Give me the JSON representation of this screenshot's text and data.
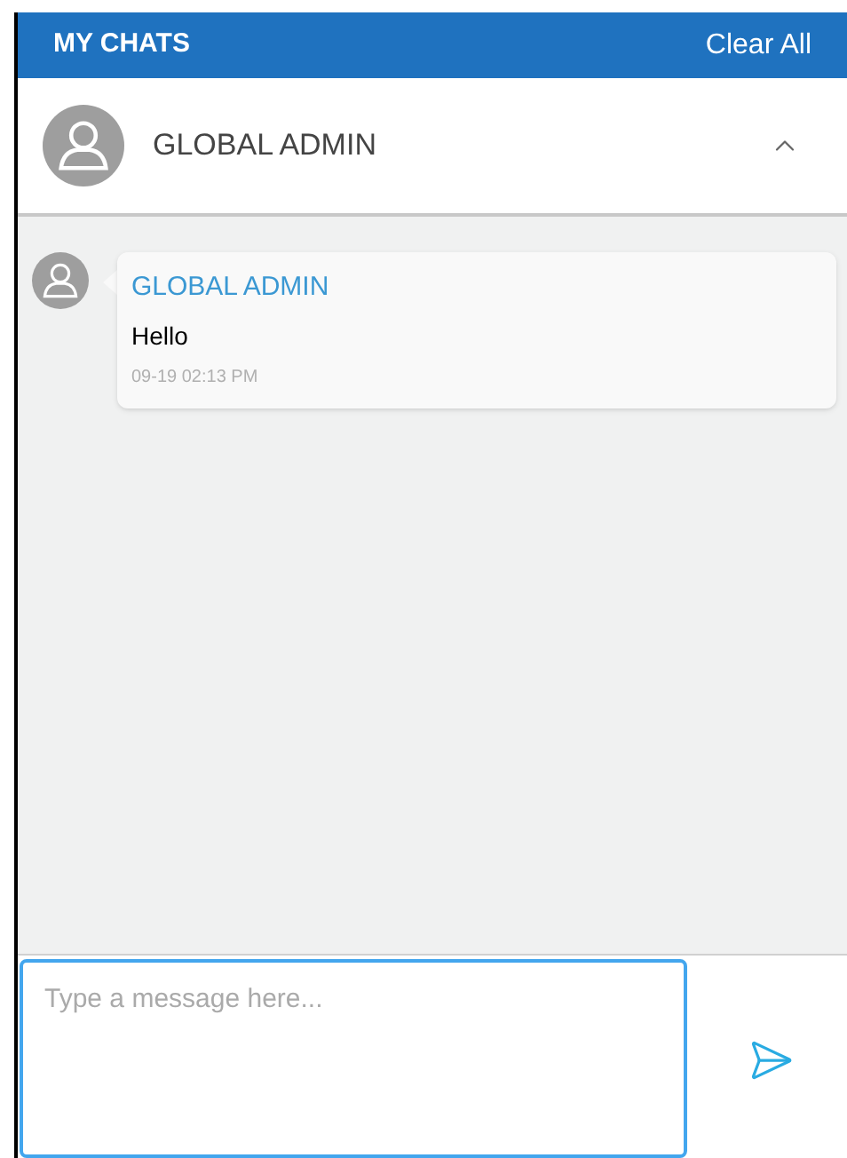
{
  "header": {
    "title": "MY CHATS",
    "action": "Clear All"
  },
  "contact": {
    "name": "GLOBAL ADMIN",
    "expanded": true
  },
  "messages": [
    {
      "sender": "GLOBAL ADMIN",
      "text": "Hello",
      "time": "09-19 02:13 PM"
    }
  ],
  "composer": {
    "placeholder": "Type a message here..."
  }
}
